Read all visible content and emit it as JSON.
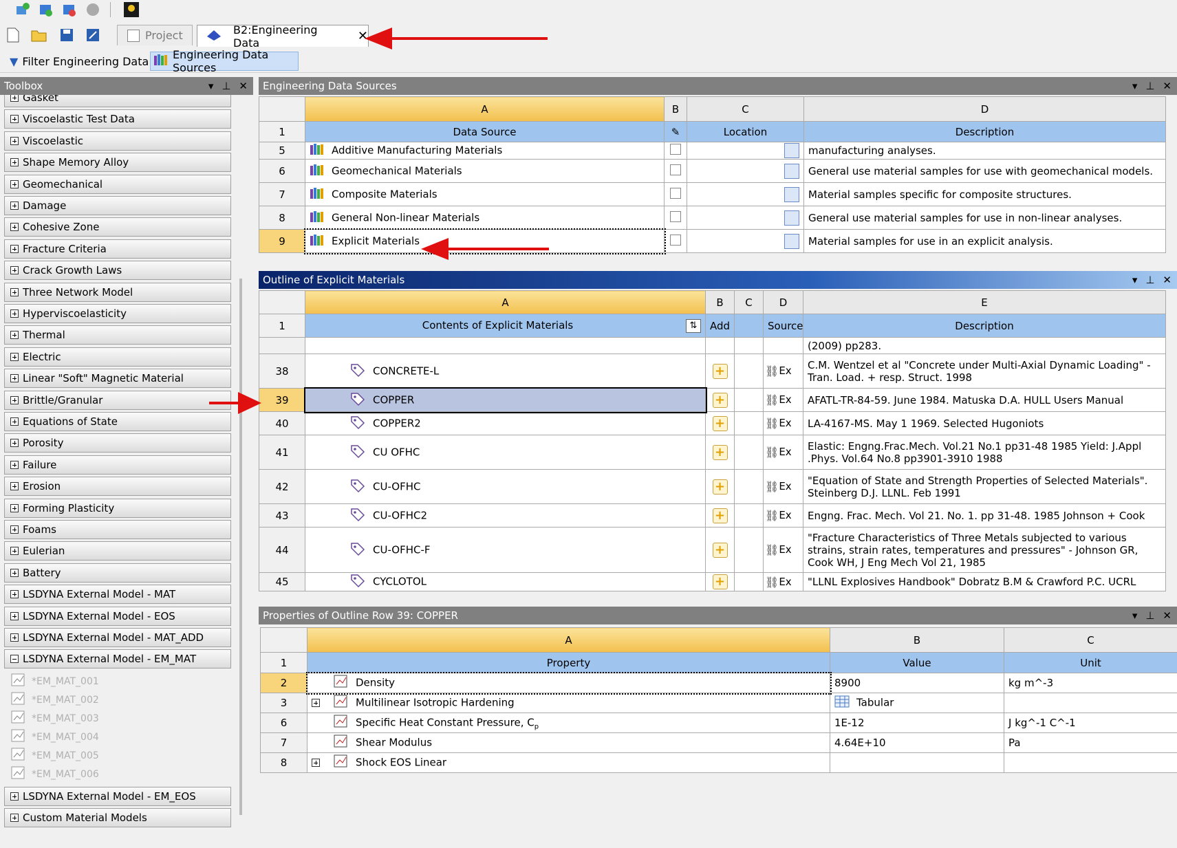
{
  "tabs": {
    "project": "Project",
    "engdata": "B2:Engineering Data"
  },
  "subtoolbar": {
    "filter": "Filter Engineering Data",
    "sources": "Engineering Data Sources"
  },
  "toolbox": {
    "title": "Toolbox",
    "items": [
      "Gasket",
      "Viscoelastic Test Data",
      "Viscoelastic",
      "Shape Memory Alloy",
      "Geomechanical",
      "Damage",
      "Cohesive Zone",
      "Fracture Criteria",
      "Crack Growth Laws",
      "Three Network Model",
      "Hyperviscoelasticity",
      "Thermal",
      "Electric",
      "Linear \"Soft\" Magnetic Material",
      "Brittle/Granular",
      "Equations of State",
      "Porosity",
      "Failure",
      "Erosion",
      "Forming Plasticity",
      "Foams",
      "Eulerian",
      "Battery",
      "LSDYNA External Model - MAT",
      "LSDYNA External Model - EOS",
      "LSDYNA External Model - MAT_ADD",
      "LSDYNA External Model - EM_MAT"
    ],
    "subitems": [
      "*EM_MAT_001",
      "*EM_MAT_002",
      "*EM_MAT_003",
      "*EM_MAT_004",
      "*EM_MAT_005",
      "*EM_MAT_006"
    ],
    "after": [
      "LSDYNA External Model - EM_EOS",
      "Custom Material Models"
    ]
  },
  "sources_panel": {
    "title": "Engineering Data Sources",
    "cols": [
      "A",
      "B",
      "C",
      "D"
    ],
    "hdr": {
      "a": "Data Source",
      "c": "Location",
      "d": "Description"
    },
    "rows": [
      {
        "n": "5",
        "name": "Additive Manufacturing Materials",
        "desc": "manufacturing analyses."
      },
      {
        "n": "6",
        "name": "Geomechanical Materials",
        "desc": "General use material samples for use with geomechanical models."
      },
      {
        "n": "7",
        "name": "Composite Materials",
        "desc": "Material samples specific for composite structures."
      },
      {
        "n": "8",
        "name": "General Non-linear Materials",
        "desc": "General use material samples for use in non-linear analyses."
      },
      {
        "n": "9",
        "name": "Explicit Materials",
        "desc": "Material samples for use in an explicit analysis."
      }
    ]
  },
  "outline_panel": {
    "title": "Outline of Explicit Materials",
    "cols": [
      "A",
      "B",
      "C",
      "D",
      "E"
    ],
    "hdr": {
      "a": "Contents of Explicit Materials",
      "b": "Add",
      "d": "Source",
      "e": "Description"
    },
    "top_desc": "(2009) pp283.",
    "rows": [
      {
        "n": "38",
        "name": "CONCRETE-L",
        "desc": "C.M. Wentzel et al \"Concrete under Multi-Axial Dynamic Loading\" - Tran. Load. + resp. Struct. 1998"
      },
      {
        "n": "39",
        "name": "COPPER",
        "desc": "AFATL-TR-84-59. June 1984. Matuska D.A. HULL Users Manual"
      },
      {
        "n": "40",
        "name": "COPPER2",
        "desc": "LA-4167-MS. May 1 1969. Selected Hugoniots"
      },
      {
        "n": "41",
        "name": "CU OFHC",
        "desc": "Elastic: Engng.Frac.Mech. Vol.21 No.1 pp31-48 1985 Yield: J.Appl .Phys. Vol.64 No.8 pp3901-3910 1988"
      },
      {
        "n": "42",
        "name": "CU-OFHC",
        "desc": "\"Equation of State and Strength Properties of Selected Materials\". Steinberg D.J. LLNL. Feb 1991"
      },
      {
        "n": "43",
        "name": "CU-OFHC2",
        "desc": "Engng. Frac. Mech. Vol 21. No. 1. pp 31-48. 1985 Johnson + Cook"
      },
      {
        "n": "44",
        "name": "CU-OFHC-F",
        "desc": "\"Fracture Characteristics of Three Metals subjected to various strains, strain rates, temperatures and pressures\" - Johnson GR, Cook WH, J Eng Mech Vol 21, 1985"
      },
      {
        "n": "45",
        "name": "CYCLOTOL",
        "desc": "\"LLNL Explosives Handbook\" Dobratz B.M & Crawford P.C. UCRL"
      }
    ],
    "src_text": "Ex"
  },
  "props_panel": {
    "title": "Properties of Outline Row 39: COPPER",
    "cols": [
      "A",
      "B",
      "C"
    ],
    "hdr": {
      "a": "Property",
      "b": "Value",
      "c": "Unit"
    },
    "rows": [
      {
        "n": "2",
        "name": "Density",
        "value": "8900",
        "unit": "kg m^-3"
      },
      {
        "n": "3",
        "name": "Multilinear Isotropic Hardening",
        "value": "Tabular",
        "unit": ""
      },
      {
        "n": "6",
        "name": "Specific Heat Constant Pressure, C",
        "sub": "p",
        "value": "1E-12",
        "unit": "J kg^-1 C^-1"
      },
      {
        "n": "7",
        "name": "Shear Modulus",
        "value": "4.64E+10",
        "unit": "Pa"
      },
      {
        "n": "8",
        "name": "Shock EOS Linear",
        "value": "",
        "unit": ""
      }
    ]
  },
  "colors": {
    "arrow": "#e01010",
    "selected_row": "#b8c4e0",
    "header_a": "#f2c04e",
    "subheader": "#9fc5ef"
  }
}
